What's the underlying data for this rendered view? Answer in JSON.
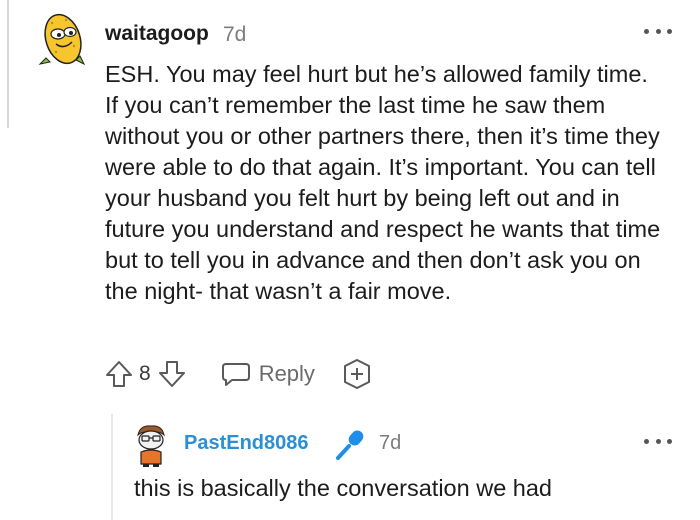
{
  "comment": {
    "username": "waitagoop",
    "age": "7d",
    "avatar_icon": "corn-avatar-icon",
    "body": "ESH. You may feel hurt but he’s allowed family time. If you can’t remember the last time he saw them without you or other partners there, then it’s time they were able to do that again. It’s important. You can tell your husband you felt hurt by being left out and in future you understand and respect he wants that time but to tell you in advance and then don’t ask you on the night- that wasn’t a fair move.",
    "score": "8",
    "reply_label": "Reply",
    "icons": {
      "upvote": "upvote-arrow-icon",
      "downvote": "downvote-arrow-icon",
      "reply": "speech-bubble-icon",
      "award": "award-plus-icon",
      "more": "more-dots-icon"
    }
  },
  "reply": {
    "username": "PastEnd8086",
    "age": "7d",
    "avatar_icon": "snoo-avatar-icon",
    "badge_icon": "microphone-icon",
    "body": "this is basically the conversation we had"
  },
  "colors": {
    "username_link": "#2b8fd6",
    "text": "#1c1c1c",
    "meta": "#7c7c7c",
    "avatar_yellow": "#f7c52e"
  }
}
